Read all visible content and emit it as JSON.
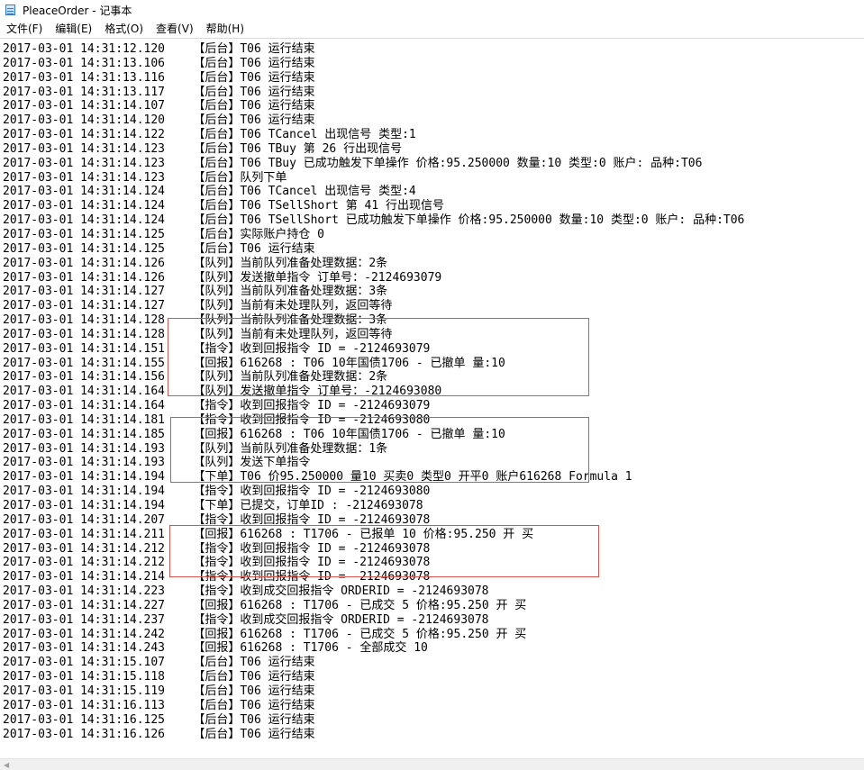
{
  "window": {
    "title": "PleaceOrder - 记事本"
  },
  "menu": [
    {
      "label": "文件(F)"
    },
    {
      "label": "编辑(E)"
    },
    {
      "label": "格式(O)"
    },
    {
      "label": "查看(V)"
    },
    {
      "label": "帮助(H)"
    }
  ],
  "lines": [
    "2017-03-01 14:31:12.120    【后台】T06 运行结束",
    "2017-03-01 14:31:13.106    【后台】T06 运行结束",
    "2017-03-01 14:31:13.116    【后台】T06 运行结束",
    "2017-03-01 14:31:13.117    【后台】T06 运行结束",
    "2017-03-01 14:31:14.107    【后台】T06 运行结束",
    "2017-03-01 14:31:14.120    【后台】T06 运行结束",
    "2017-03-01 14:31:14.122    【后台】T06 TCancel 出现信号 类型:1",
    "2017-03-01 14:31:14.123    【后台】T06 TBuy 第 26 行出现信号",
    "2017-03-01 14:31:14.123    【后台】T06 TBuy 已成功触发下单操作 价格:95.250000 数量:10 类型:0 账户: 品种:T06",
    "2017-03-01 14:31:14.123    【后台】队列下单",
    "2017-03-01 14:31:14.124    【后台】T06 TCancel 出现信号 类型:4",
    "2017-03-01 14:31:14.124    【后台】T06 TSellShort 第 41 行出现信号",
    "2017-03-01 14:31:14.124    【后台】T06 TSellShort 已成功触发下单操作 价格:95.250000 数量:10 类型:0 账户: 品种:T06",
    "2017-03-01 14:31:14.125    【后台】实际账户持仓 0",
    "2017-03-01 14:31:14.125    【后台】T06 运行结束",
    "2017-03-01 14:31:14.126    【队列】当前队列准备处理数据：2条",
    "2017-03-01 14:31:14.126    【队列】发送撤单指令 订单号：-2124693079",
    "2017-03-01 14:31:14.127    【队列】当前队列准备处理数据：3条",
    "2017-03-01 14:31:14.127    【队列】当前有未处理队列，返回等待",
    "2017-03-01 14:31:14.128    【队列】当前队列准备处理数据：3条",
    "2017-03-01 14:31:14.128    【队列】当前有未处理队列，返回等待",
    "2017-03-01 14:31:14.151    【指令】收到回报指令 ID = -2124693079",
    "2017-03-01 14:31:14.155    【回报】616268 : T06 10年国债1706 - 已撤单 量:10",
    "2017-03-01 14:31:14.156    【队列】当前队列准备处理数据：2条",
    "2017-03-01 14:31:14.164    【队列】发送撤单指令 订单号：-2124693080",
    "2017-03-01 14:31:14.164    【指令】收到回报指令 ID = -2124693079",
    "2017-03-01 14:31:14.181    【指令】收到回报指令 ID = -2124693080",
    "2017-03-01 14:31:14.185    【回报】616268 : T06 10年国债1706 - 已撤单 量:10",
    "2017-03-01 14:31:14.193    【队列】当前队列准备处理数据：1条",
    "2017-03-01 14:31:14.193    【队列】发送下单指令",
    "2017-03-01 14:31:14.194    【下单】T06 价95.250000 量10 买卖0 类型0 开平0 账户616268 Formula 1",
    "2017-03-01 14:31:14.194    【指令】收到回报指令 ID = -2124693080",
    "2017-03-01 14:31:14.194    【下单】已提交，订单ID : -2124693078",
    "2017-03-01 14:31:14.207    【指令】收到回报指令 ID = -2124693078",
    "2017-03-01 14:31:14.211    【回报】616268 : T1706 - 已报单 10 价格:95.250 开 买",
    "2017-03-01 14:31:14.212    【指令】收到回报指令 ID = -2124693078",
    "2017-03-01 14:31:14.212    【指令】收到回报指令 ID = -2124693078",
    "2017-03-01 14:31:14.214    【指令】收到回报指令 ID = -2124693078",
    "2017-03-01 14:31:14.223    【指令】收到成交回报指令 ORDERID = -2124693078",
    "2017-03-01 14:31:14.227    【回报】616268 : T1706 - 已成交 5 价格:95.250 开 买",
    "2017-03-01 14:31:14.237    【指令】收到成交回报指令 ORDERID = -2124693078",
    "2017-03-01 14:31:14.242    【回报】616268 : T1706 - 已成交 5 价格:95.250 开 买",
    "2017-03-01 14:31:14.243    【回报】616268 : T1706 - 全部成交 10",
    "2017-03-01 14:31:15.107    【后台】T06 运行结束",
    "2017-03-01 14:31:15.118    【后台】T06 运行结束",
    "2017-03-01 14:31:15.119    【后台】T06 运行结束",
    "2017-03-01 14:31:16.113    【后台】T06 运行结束",
    "2017-03-01 14:31:16.125    【后台】T06 运行结束",
    "2017-03-01 14:31:16.126    【后台】T06 运行结束"
  ],
  "highlight_color": "#d9534f"
}
